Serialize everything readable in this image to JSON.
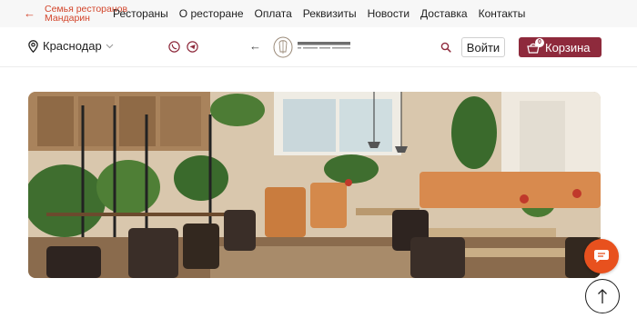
{
  "topbar": {
    "back_line1": "Семья ресторанов",
    "back_line2": "Мандарин",
    "accent_color": "#d3452b",
    "nav": [
      {
        "label": "Рестораны"
      },
      {
        "label": "О ресторане"
      },
      {
        "label": "Оплата"
      },
      {
        "label": "Реквизиты"
      },
      {
        "label": "Новости"
      },
      {
        "label": "Доставка"
      },
      {
        "label": "Контакты"
      }
    ]
  },
  "header": {
    "city": "Краснодар",
    "city_icon": "location-pin-icon",
    "social": [
      "whatsapp-icon",
      "telegram-icon"
    ],
    "logo_icon": "restaurant-logo",
    "login_label": "Войти",
    "cart_label": "Корзина",
    "cart_count": "0",
    "cart_color": "#8e2a3c"
  },
  "hero": {
    "image": "restaurant-interior-photo"
  },
  "floating": {
    "chat_icon": "chat-bubble-icon",
    "chat_color": "#e8511e",
    "scroll_top_icon": "arrow-up-icon"
  }
}
